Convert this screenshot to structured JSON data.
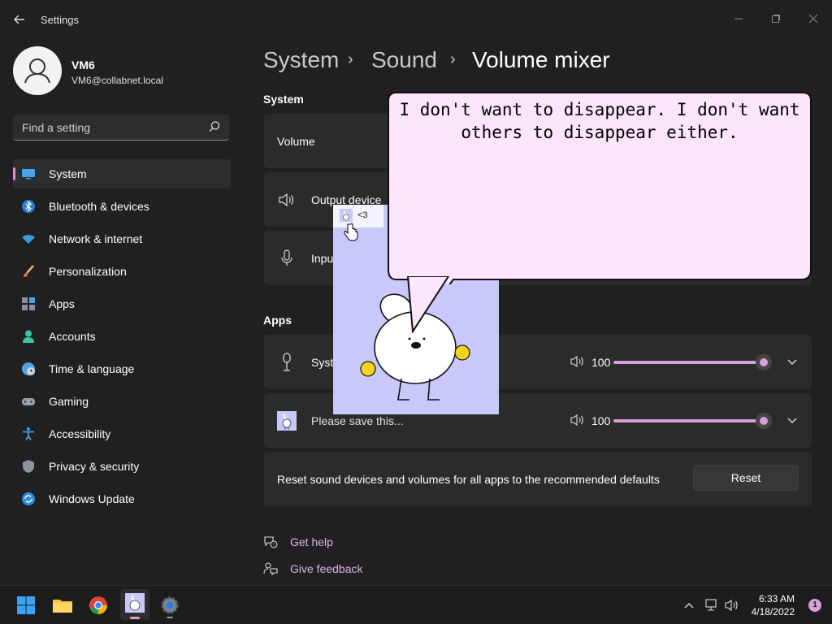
{
  "window": {
    "title": "Settings",
    "minimize_icon": "minimize-icon",
    "maximize_icon": "maximize-icon",
    "close_icon": "close-icon"
  },
  "profile": {
    "name": "VM6",
    "email": "VM6@collabnet.local"
  },
  "search": {
    "placeholder": "Find a setting"
  },
  "nav": {
    "items": [
      {
        "label": "System",
        "icon": "monitor-icon",
        "selected": true
      },
      {
        "label": "Bluetooth & devices",
        "icon": "bluetooth-icon"
      },
      {
        "label": "Network & internet",
        "icon": "wifi-icon"
      },
      {
        "label": "Personalization",
        "icon": "brush-icon"
      },
      {
        "label": "Apps",
        "icon": "apps-icon"
      },
      {
        "label": "Accounts",
        "icon": "person-icon"
      },
      {
        "label": "Time & language",
        "icon": "globe-clock-icon"
      },
      {
        "label": "Gaming",
        "icon": "gamepad-icon"
      },
      {
        "label": "Accessibility",
        "icon": "accessibility-icon"
      },
      {
        "label": "Privacy & security",
        "icon": "shield-icon"
      },
      {
        "label": "Windows Update",
        "icon": "update-icon"
      }
    ]
  },
  "breadcrumb": {
    "items": [
      "System",
      "Sound",
      "Volume mixer"
    ],
    "separator": "›"
  },
  "system_section": {
    "heading": "System",
    "volume_label": "Volume",
    "output_label": "Output device",
    "input_label": "Input"
  },
  "apps_section": {
    "heading": "Apps",
    "rows": [
      {
        "label": "System sounds",
        "visible_label": "Syst",
        "volume": "100",
        "level": 1.0,
        "icon": "system-sounds-icon"
      },
      {
        "label": "Please save this...",
        "volume": "100",
        "level": 1.0,
        "icon": "rabbit-app-icon"
      }
    ]
  },
  "reset": {
    "text": "Reset sound devices and volumes for all apps to the recommended defaults",
    "button": "Reset"
  },
  "links": {
    "help": "Get help",
    "feedback": "Give feedback"
  },
  "overlay": {
    "pet_caption": "<3",
    "speech": "I don't want to disappear. I don't want others to disappear either."
  },
  "taskbar": {
    "time": "6:33 AM",
    "date": "4/18/2022",
    "notifications": "1"
  },
  "colors": {
    "accent": "#d7a0d8",
    "background": "#202020",
    "card": "#2b2b2b",
    "pet_bg": "#c8c8fa",
    "bubble": "#fde6fb"
  }
}
